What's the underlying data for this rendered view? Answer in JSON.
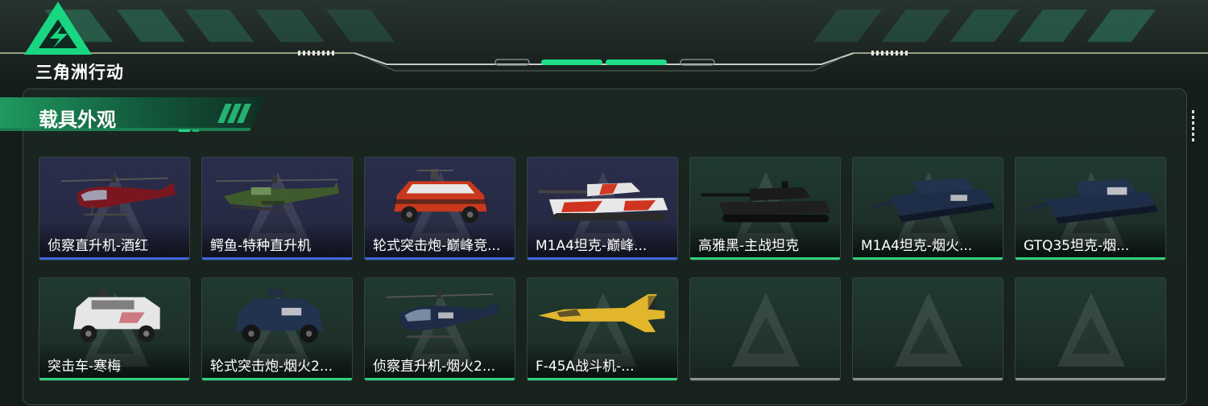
{
  "app": {
    "logo_text": "三角洲行动",
    "section_title": "载具外观"
  },
  "colors": {
    "rarity_blue": "#3b66e0",
    "rarity_green": "#2fd17a",
    "empty_bar": "#8a918e",
    "accent": "#1fdc86"
  },
  "vehicles": [
    {
      "name": "侦察直升机-酒红",
      "rarity": "blue",
      "icon": "helicopter-red-icon"
    },
    {
      "name": "鳄鱼-特种直升机",
      "rarity": "blue",
      "icon": "attack-helicopter-icon"
    },
    {
      "name": "轮式突击炮-巅峰竞...",
      "rarity": "blue",
      "icon": "armored-car-red-icon"
    },
    {
      "name": "M1A4坦克-巅峰...",
      "rarity": "blue",
      "icon": "tank-red-white-icon"
    },
    {
      "name": "高雅黑-主战坦克",
      "rarity": "green",
      "icon": "tank-black-icon"
    },
    {
      "name": "M1A4坦克-烟火...",
      "rarity": "green",
      "icon": "tank-navy-icon"
    },
    {
      "name": "GTQ35坦克-烟...",
      "rarity": "green",
      "icon": "tank-navy-2025-icon"
    },
    {
      "name": "突击车-寒梅",
      "rarity": "green",
      "icon": "assault-vehicle-white-icon"
    },
    {
      "name": "轮式突击炮-烟火2...",
      "rarity": "green",
      "icon": "armored-car-navy-icon"
    },
    {
      "name": "侦察直升机-烟火2...",
      "rarity": "green",
      "icon": "helicopter-navy-icon"
    },
    {
      "name": "F-45A战斗机-...",
      "rarity": "green",
      "icon": "fighter-jet-yellow-icon"
    },
    {
      "name": "",
      "rarity": "empty",
      "icon": "empty-slot-icon"
    },
    {
      "name": "",
      "rarity": "empty",
      "icon": "empty-slot-icon"
    },
    {
      "name": "",
      "rarity": "empty",
      "icon": "empty-slot-icon"
    }
  ]
}
